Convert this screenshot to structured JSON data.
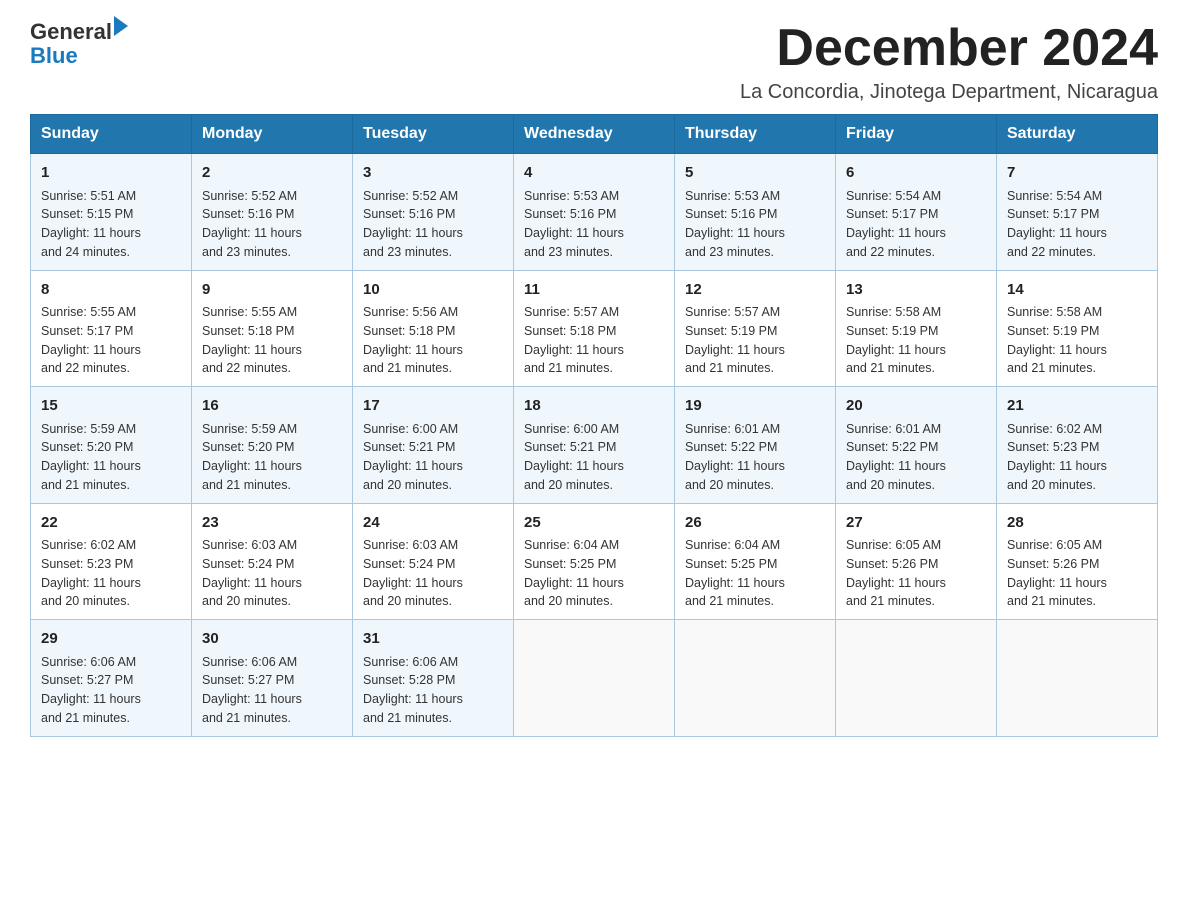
{
  "logo": {
    "text_general": "General",
    "text_blue": "Blue"
  },
  "header": {
    "month_title": "December 2024",
    "location": "La Concordia, Jinotega Department, Nicaragua"
  },
  "days_of_week": [
    "Sunday",
    "Monday",
    "Tuesday",
    "Wednesday",
    "Thursday",
    "Friday",
    "Saturday"
  ],
  "weeks": [
    [
      {
        "day": "1",
        "sunrise": "5:51 AM",
        "sunset": "5:15 PM",
        "daylight": "11 hours and 24 minutes."
      },
      {
        "day": "2",
        "sunrise": "5:52 AM",
        "sunset": "5:16 PM",
        "daylight": "11 hours and 23 minutes."
      },
      {
        "day": "3",
        "sunrise": "5:52 AM",
        "sunset": "5:16 PM",
        "daylight": "11 hours and 23 minutes."
      },
      {
        "day": "4",
        "sunrise": "5:53 AM",
        "sunset": "5:16 PM",
        "daylight": "11 hours and 23 minutes."
      },
      {
        "day": "5",
        "sunrise": "5:53 AM",
        "sunset": "5:16 PM",
        "daylight": "11 hours and 23 minutes."
      },
      {
        "day": "6",
        "sunrise": "5:54 AM",
        "sunset": "5:17 PM",
        "daylight": "11 hours and 22 minutes."
      },
      {
        "day": "7",
        "sunrise": "5:54 AM",
        "sunset": "5:17 PM",
        "daylight": "11 hours and 22 minutes."
      }
    ],
    [
      {
        "day": "8",
        "sunrise": "5:55 AM",
        "sunset": "5:17 PM",
        "daylight": "11 hours and 22 minutes."
      },
      {
        "day": "9",
        "sunrise": "5:55 AM",
        "sunset": "5:18 PM",
        "daylight": "11 hours and 22 minutes."
      },
      {
        "day": "10",
        "sunrise": "5:56 AM",
        "sunset": "5:18 PM",
        "daylight": "11 hours and 21 minutes."
      },
      {
        "day": "11",
        "sunrise": "5:57 AM",
        "sunset": "5:18 PM",
        "daylight": "11 hours and 21 minutes."
      },
      {
        "day": "12",
        "sunrise": "5:57 AM",
        "sunset": "5:19 PM",
        "daylight": "11 hours and 21 minutes."
      },
      {
        "day": "13",
        "sunrise": "5:58 AM",
        "sunset": "5:19 PM",
        "daylight": "11 hours and 21 minutes."
      },
      {
        "day": "14",
        "sunrise": "5:58 AM",
        "sunset": "5:19 PM",
        "daylight": "11 hours and 21 minutes."
      }
    ],
    [
      {
        "day": "15",
        "sunrise": "5:59 AM",
        "sunset": "5:20 PM",
        "daylight": "11 hours and 21 minutes."
      },
      {
        "day": "16",
        "sunrise": "5:59 AM",
        "sunset": "5:20 PM",
        "daylight": "11 hours and 21 minutes."
      },
      {
        "day": "17",
        "sunrise": "6:00 AM",
        "sunset": "5:21 PM",
        "daylight": "11 hours and 20 minutes."
      },
      {
        "day": "18",
        "sunrise": "6:00 AM",
        "sunset": "5:21 PM",
        "daylight": "11 hours and 20 minutes."
      },
      {
        "day": "19",
        "sunrise": "6:01 AM",
        "sunset": "5:22 PM",
        "daylight": "11 hours and 20 minutes."
      },
      {
        "day": "20",
        "sunrise": "6:01 AM",
        "sunset": "5:22 PM",
        "daylight": "11 hours and 20 minutes."
      },
      {
        "day": "21",
        "sunrise": "6:02 AM",
        "sunset": "5:23 PM",
        "daylight": "11 hours and 20 minutes."
      }
    ],
    [
      {
        "day": "22",
        "sunrise": "6:02 AM",
        "sunset": "5:23 PM",
        "daylight": "11 hours and 20 minutes."
      },
      {
        "day": "23",
        "sunrise": "6:03 AM",
        "sunset": "5:24 PM",
        "daylight": "11 hours and 20 minutes."
      },
      {
        "day": "24",
        "sunrise": "6:03 AM",
        "sunset": "5:24 PM",
        "daylight": "11 hours and 20 minutes."
      },
      {
        "day": "25",
        "sunrise": "6:04 AM",
        "sunset": "5:25 PM",
        "daylight": "11 hours and 20 minutes."
      },
      {
        "day": "26",
        "sunrise": "6:04 AM",
        "sunset": "5:25 PM",
        "daylight": "11 hours and 21 minutes."
      },
      {
        "day": "27",
        "sunrise": "6:05 AM",
        "sunset": "5:26 PM",
        "daylight": "11 hours and 21 minutes."
      },
      {
        "day": "28",
        "sunrise": "6:05 AM",
        "sunset": "5:26 PM",
        "daylight": "11 hours and 21 minutes."
      }
    ],
    [
      {
        "day": "29",
        "sunrise": "6:06 AM",
        "sunset": "5:27 PM",
        "daylight": "11 hours and 21 minutes."
      },
      {
        "day": "30",
        "sunrise": "6:06 AM",
        "sunset": "5:27 PM",
        "daylight": "11 hours and 21 minutes."
      },
      {
        "day": "31",
        "sunrise": "6:06 AM",
        "sunset": "5:28 PM",
        "daylight": "11 hours and 21 minutes."
      },
      null,
      null,
      null,
      null
    ]
  ],
  "labels": {
    "sunrise_prefix": "Sunrise: ",
    "sunset_prefix": "Sunset: ",
    "daylight_prefix": "Daylight: "
  }
}
